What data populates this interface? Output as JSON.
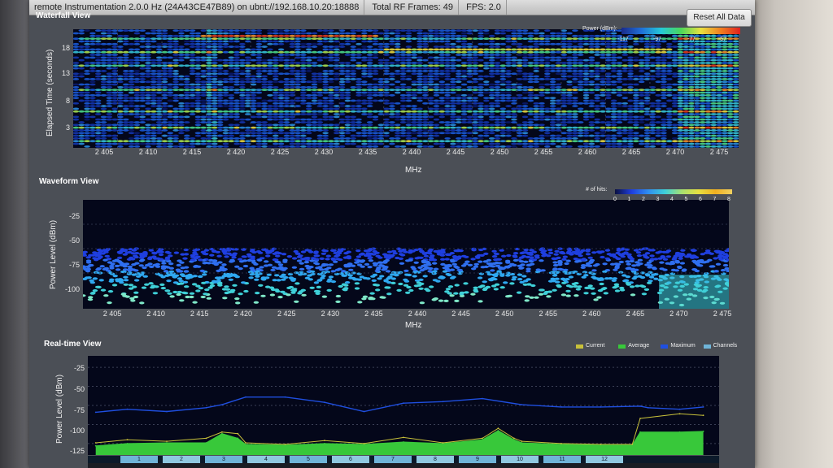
{
  "window": {
    "title_segments": [
      "remote Instrumentation 2.0.0 Hz (24A43CE47B89) on ubnt://192.168.10.20:18888",
      "Total RF Frames: 49",
      "FPS: 2.0"
    ],
    "reset_label": "Reset All Data"
  },
  "colors": {
    "plot_bg": "#04071a",
    "current": "#c8c13a",
    "average": "#38c83a",
    "maximum": "#1f4fe0",
    "channels": "#6fb4d8"
  },
  "waterfall": {
    "title": "Waterfall View",
    "ylabel": "Elapsed Time (seconds)",
    "xlabel": "MHz",
    "yticks": [
      "18",
      "13",
      "8",
      "3"
    ],
    "xticks": [
      "2 405",
      "2 410",
      "2 415",
      "2 420",
      "2 425",
      "2 430",
      "2 435",
      "2 440",
      "2 445",
      "2 450",
      "2 455",
      "2 460",
      "2 465",
      "2 470",
      "2 475"
    ],
    "legend_title": "Power (dBm):",
    "legend_ticks": [
      "-117",
      "-97",
      "-77",
      "-57"
    ]
  },
  "waveform": {
    "title": "Waveform View",
    "ylabel": "Power Level (dBm)",
    "xlabel": "MHz",
    "yticks": [
      "-25",
      "-50",
      "-75",
      "-100"
    ],
    "xticks": [
      "2 405",
      "2 410",
      "2 415",
      "2 420",
      "2 425",
      "2 430",
      "2 435",
      "2 440",
      "2 445",
      "2 450",
      "2 455",
      "2 460",
      "2 465",
      "2 470",
      "2 475"
    ],
    "legend_title": "# of hits:",
    "legend_ticks": [
      "0",
      "1",
      "2",
      "3",
      "4",
      "5",
      "6",
      "7",
      "8"
    ]
  },
  "realtime": {
    "title": "Real-time View",
    "ylabel": "Power Level (dBm)",
    "yticks": [
      "-25",
      "-50",
      "-75",
      "-100",
      "-125"
    ],
    "legend": [
      {
        "label": "Current",
        "color_key": "current"
      },
      {
        "label": "Average",
        "color_key": "average"
      },
      {
        "label": "Maximum",
        "color_key": "maximum"
      },
      {
        "label": "Channels",
        "color_key": "channels"
      }
    ],
    "channels": [
      "1",
      "2",
      "3",
      "4",
      "5",
      "6",
      "7",
      "8",
      "9",
      "10",
      "11",
      "12"
    ],
    "chart_data": {
      "type": "line",
      "x_range": [
        2400,
        2480
      ],
      "ylim": [
        -140,
        -10
      ],
      "series": [
        {
          "name": "Maximum",
          "x": [
            2401,
            2405,
            2410,
            2415,
            2417,
            2420,
            2425,
            2430,
            2435,
            2440,
            2445,
            2450,
            2455,
            2460,
            2465,
            2470,
            2471,
            2475,
            2478
          ],
          "values": [
            -84,
            -80,
            -83,
            -78,
            -74,
            -64,
            -64,
            -71,
            -83,
            -72,
            -70,
            -66,
            -74,
            -77,
            -77,
            -76,
            -78,
            -80,
            -77
          ]
        },
        {
          "name": "Average",
          "x": [
            2401,
            2405,
            2410,
            2415,
            2417,
            2419,
            2420,
            2425,
            2430,
            2435,
            2440,
            2445,
            2450,
            2452,
            2454,
            2455,
            2460,
            2465,
            2469,
            2470,
            2475,
            2478
          ],
          "values": [
            -128,
            -125,
            -124,
            -124,
            -112,
            -118,
            -126,
            -127,
            -125,
            -126,
            -123,
            -125,
            -120,
            -108,
            -120,
            -124,
            -126,
            -127,
            -127,
            -110,
            -110,
            -109
          ]
        },
        {
          "name": "Current",
          "x": [
            2401,
            2405,
            2410,
            2415,
            2417,
            2419,
            2420,
            2425,
            2430,
            2435,
            2440,
            2445,
            2450,
            2452,
            2454,
            2455,
            2460,
            2465,
            2469,
            2470,
            2475,
            2478
          ],
          "values": [
            -124,
            -120,
            -122,
            -118,
            -110,
            -112,
            -124,
            -126,
            -121,
            -125,
            -117,
            -124,
            -118,
            -105,
            -118,
            -122,
            -125,
            -126,
            -126,
            -92,
            -86,
            -88
          ]
        }
      ]
    }
  }
}
